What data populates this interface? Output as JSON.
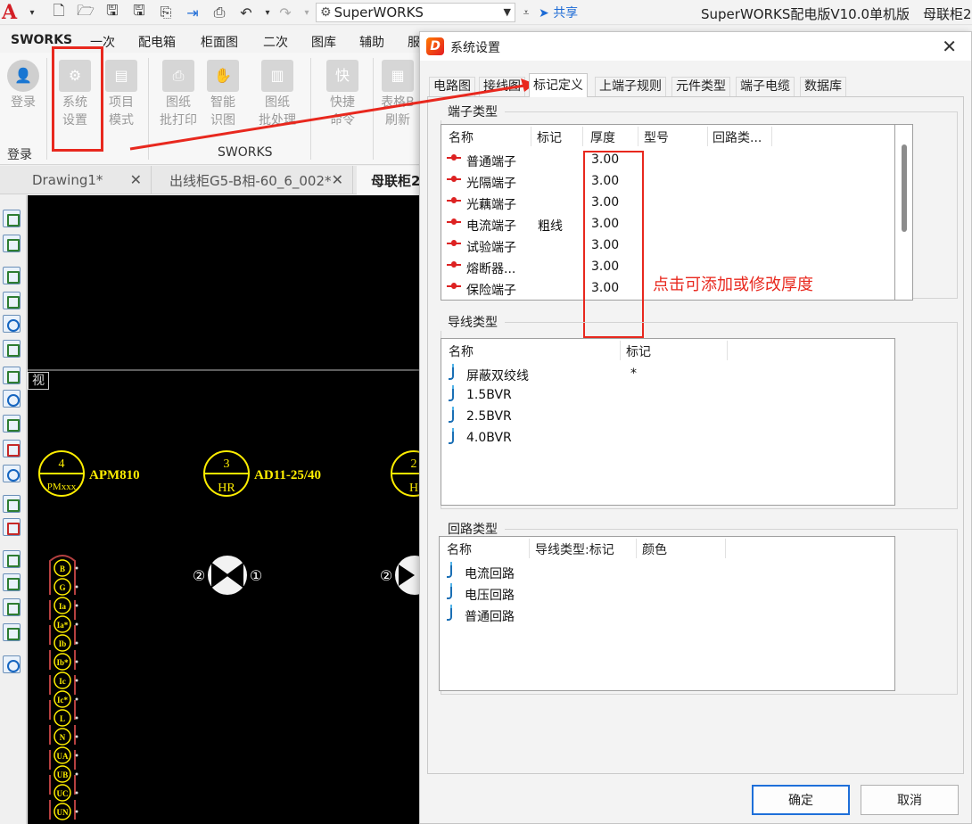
{
  "titlebar": {
    "workspace": "SuperWORKS",
    "share": "共享",
    "app_title": "SuperWORKS配电版V10.0单机版　母联柜2("
  },
  "ribbon": {
    "tabs": [
      "SWORKS",
      "一次",
      "配电箱",
      "柜面图",
      "二次",
      "图库",
      "辅助",
      "服"
    ],
    "buttons": {
      "login": [
        "登录"
      ],
      "settings": [
        "系统",
        "设置"
      ],
      "project_mode": [
        "项目",
        "模式"
      ],
      "batch_print": [
        "图纸",
        "批打印"
      ],
      "smart_recog": [
        "智能",
        "识图"
      ],
      "batch_process": [
        "图纸",
        "批处理"
      ],
      "quick_cmd": [
        "快捷",
        "命令"
      ],
      "refresh": [
        "表格B",
        "刷新"
      ]
    },
    "groups": {
      "login": "登录",
      "sworks": "SWORKS"
    }
  },
  "doc_tabs": [
    "Drawing1*",
    "出线柜G5-B相-60_6_002*",
    "母联柜2"
  ],
  "canvas": {
    "view_label": "视",
    "symbols": [
      {
        "num": "4",
        "sub": "PMxxx",
        "label": "APM810"
      },
      {
        "num": "3",
        "sub": "HR",
        "label": "AD11-25/40"
      },
      {
        "num": "2",
        "sub": "H",
        "label": ""
      }
    ],
    "terminals": [
      "B",
      "G",
      "Ia",
      "Ia*",
      "Ib",
      "Ib*",
      "Ic",
      "Ic*",
      "L",
      "N",
      "UA",
      "UB",
      "UC",
      "UN"
    ],
    "ct_labels": [
      "②",
      "①"
    ]
  },
  "dialog": {
    "title": "系统设置",
    "tabs": [
      "电路图",
      "接线图",
      "标记定义",
      "上端子规则",
      "元件类型",
      "端子电缆",
      "数据库"
    ],
    "terminal_group": {
      "title": "端子类型",
      "headers": [
        "名称",
        "标记",
        "厚度",
        "型号",
        "回路类..."
      ],
      "rows": [
        {
          "name": "普通端子",
          "mark": "",
          "thickness": "3.00"
        },
        {
          "name": "光隔端子",
          "mark": "",
          "thickness": "3.00"
        },
        {
          "name": "光藕端子",
          "mark": "",
          "thickness": "3.00"
        },
        {
          "name": "电流端子",
          "mark": "粗线",
          "thickness": "3.00"
        },
        {
          "name": "试验端子",
          "mark": "",
          "thickness": "3.00"
        },
        {
          "name": "熔断器...",
          "mark": "",
          "thickness": "3.00"
        },
        {
          "name": "保险端子",
          "mark": "",
          "thickness": "3.00"
        }
      ]
    },
    "wire_group": {
      "title": "导线类型",
      "headers": [
        "名称",
        "标记"
      ],
      "rows": [
        {
          "name": "屏蔽双绞线",
          "mark": "*"
        },
        {
          "name": "1.5BVR",
          "mark": ""
        },
        {
          "name": "2.5BVR",
          "mark": ""
        },
        {
          "name": "4.0BVR",
          "mark": ""
        }
      ]
    },
    "circuit_group": {
      "title": "回路类型",
      "headers": [
        "名称",
        "导线类型:标记",
        "颜色"
      ],
      "rows": [
        {
          "name": "电流回路"
        },
        {
          "name": "电压回路"
        },
        {
          "name": "普通回路"
        }
      ]
    },
    "annotation": "点击可添加或修改厚度",
    "ok": "确定",
    "cancel": "取消"
  },
  "colors": {
    "accent_red": "#e8281e",
    "primary_blue": "#1e6fd9",
    "canvas_yellow": "#ffee00"
  }
}
